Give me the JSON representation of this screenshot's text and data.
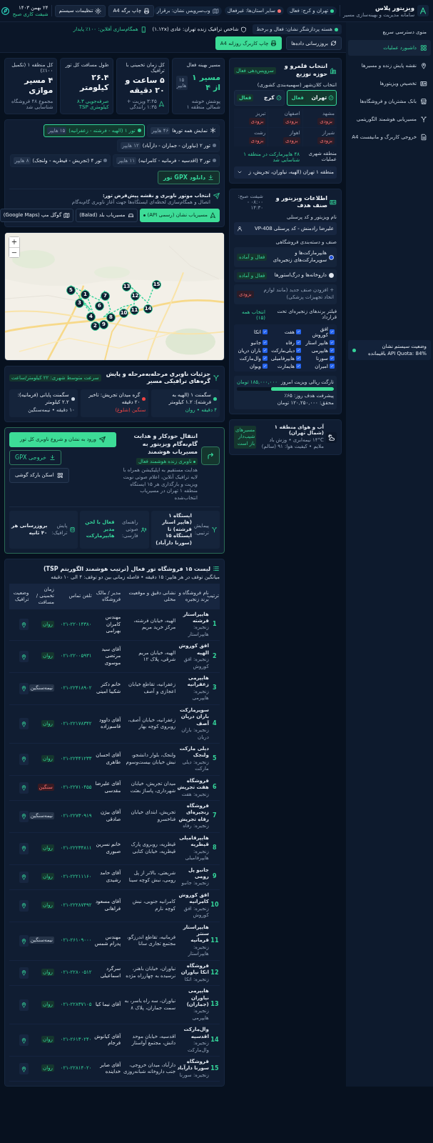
{
  "header": {
    "title": "ویزیتور پلاس",
    "subtitle": "سامانه مدیریت و بهینه‌سازی مسیر",
    "pills": [
      {
        "label": "تهران و کرج: فعال",
        "color": "#34d399"
      },
      {
        "label": "سایر استان‌ها: غیرفعال",
        "color": "#f87171"
      },
      {
        "label": "وب‌سرویس نشان: برقرار"
      }
    ],
    "buttons": [
      "چاپ برگه A4",
      "تنظیمات سیستم"
    ],
    "date": "۲۴ بهمن ۱۴۰۳",
    "shift": "شیفت کاری صبح"
  },
  "toolbar": {
    "statuses": [
      "هسته پردازشگر نشان: فعال و برخط",
      "شاخص ترافیک زنده تهران: عادی (۱.۱۲x)",
      "همگام‌سازی آفلاین: ۱۰۰٪ پایدار"
    ],
    "buttons": [
      {
        "label": "بروزرسانی داده‌ها",
        "kind": "secondary"
      },
      {
        "label": "چاپ کاربرگ روزانه A4",
        "kind": "primary"
      }
    ]
  },
  "sidebar": {
    "title": "منوی دسترسی سریع",
    "items": [
      {
        "label": "داشبورد عملیات",
        "selected": true
      },
      {
        "label": "نقشه پایش زنده و مسیرها",
        "selected": false
      },
      {
        "label": "تخصیص ویزیتورها",
        "selected": false
      },
      {
        "label": "بانک مشتریان و فروشگاه‌ها",
        "selected": false
      },
      {
        "label": "مسیریابی هوشمند الگوریتمی",
        "selected": false
      },
      {
        "label": "خروجی کاربرگ و مانیفست A4",
        "selected": false
      }
    ],
    "status": {
      "title": "وضعیت سیستم نشان",
      "quota": "API Quota: 84% باقیمانده"
    }
  },
  "stats": [
    {
      "label": "مسیر بهینه فعال",
      "value": "مسیر ۱ از ۴",
      "badge": "۱۵ هایپر",
      "note": "پوشش خوشه شمالی منطقه ۱",
      "value_accent": true,
      "note_accent": false
    },
    {
      "label": "کل زمان تخمینی با ترافیک",
      "value": "۵ ساعت و ۲۰ دقیقه",
      "note": "۳:۴۵ ویزیت + ۱:۳۵ رانندگی",
      "value_accent": false,
      "note_accent": false
    },
    {
      "label": "طول مسافت کل تور",
      "value": "۲۶.۴ کیلومتر",
      "note": "صرفه‌جویی ۸.۳ کیلومتری TSP",
      "value_accent": false,
      "note_accent": true
    },
    {
      "label": "کل منطقه ۱ (تکمیل ۱۰۰٪)",
      "value": "۴ مسیر موازی",
      "note": "مجموع ۴۸ فروشگاه شناسایی شد",
      "value_accent": false,
      "note_accent": false
    }
  ],
  "territory": {
    "title": "انتخاب قلمرو و حوزه توزیع",
    "badge": "سرویس‌دهی فعال",
    "city_label": "انتخاب کلان‌شهر (سهمیه‌بندی کشوری)",
    "cities": [
      {
        "name": "تهران",
        "badge": "فعال",
        "selected": true,
        "disabled": false
      },
      {
        "name": "کرج",
        "badge": "فعال",
        "selected": false,
        "disabled": false
      },
      {
        "name": "مشهد",
        "badge": "بزودی",
        "selected": false,
        "disabled": true
      },
      {
        "name": "اصفهان",
        "badge": "بزودی",
        "selected": false,
        "disabled": true
      },
      {
        "name": "تبریز",
        "badge": "بزودی",
        "selected": false,
        "disabled": true
      },
      {
        "name": "شیراز",
        "badge": "بزودی",
        "selected": false,
        "disabled": true
      },
      {
        "name": "اهواز",
        "badge": "بزودی",
        "selected": false,
        "disabled": true
      },
      {
        "name": "رشت",
        "badge": "بزودی",
        "selected": false,
        "disabled": true
      }
    ],
    "region_label": "منطقه شهری عملیات",
    "region_count": "۴۸ هایپرمارکت در منطقه ۱ شناسایی شد",
    "region_value": "منطقه ۱ تهران (الهیه، نیاوران، تجریش، ز"
  },
  "salesperson": {
    "title": "اطلاعات ویزیتور و صنف هدف",
    "shift": "شیفت صبح: ۰۸:۰۰ - ۱۴:۳۰",
    "name_label": "نام ویزیتور و کد پرسنلی",
    "name_value": "علیرضا رادمنش - کد پرسنلی VP-408",
    "category_label": "صنف و دسته‌بندی فروشگاهی",
    "categories": [
      {
        "kind": "radio",
        "label": "هایپرمارکت‌ها و سوپرمارکت‌های زنجیره‌ای",
        "badge": "فعال و آماده",
        "selected": true
      },
      {
        "kind": "radio",
        "label": "داروخانه‌ها و درگ‌استورها",
        "badge": "فعال و آماده",
        "selected": false
      },
      {
        "kind": "add",
        "label": "+ افزودن صنف جدید (مانند لوازم اتحاد تجهیزات پزشکی)",
        "badge": "بزودی"
      }
    ],
    "brands_label": "فیلتر برندهای زنجیره‌ای تحت قرارداد",
    "select_all": "انتخاب همه (۱۵)",
    "brands": [
      {
        "label": "افق کوروش",
        "checked": true
      },
      {
        "label": "هفت",
        "checked": true
      },
      {
        "label": "اتکا",
        "checked": true
      },
      {
        "label": "هایپر استار",
        "checked": true
      },
      {
        "label": "رفاه",
        "checked": true
      },
      {
        "label": "جانبو",
        "checked": true
      },
      {
        "label": "هایپرمی",
        "checked": true
      },
      {
        "label": "دیلی‌مارکت",
        "checked": true
      },
      {
        "label": "باران دریان",
        "checked": true
      },
      {
        "label": "سورنا",
        "checked": true
      },
      {
        "label": "هایپرفامیلی",
        "checked": true
      },
      {
        "label": "وال‌مارکت",
        "checked": true
      },
      {
        "label": "امیران",
        "checked": true
      },
      {
        "label": "هایمارت",
        "checked": true
      },
      {
        "label": "ویوان",
        "checked": true
      }
    ],
    "target": {
      "label": "تارگت ریالی ویزیت امروز",
      "amount": "۱۸۵,۰۰۰,۰۰۰ تومان",
      "level": 0.65,
      "progress": "پیشرفت هدف روز: ۶۵٪",
      "achieved": "محقق: ۱۲۰,۲۵۰,۰۰۰ تومان"
    }
  },
  "weather": {
    "title": "آب و هوای منطقه ۱ (شمال تهران)",
    "details": "۱۴°C نیمه‌ابری • وزش باد ملایم • کیفیت هوا: ۹۱ (سالم)",
    "badge": "مسیرهای شیب‌دار باز است"
  },
  "routes": {
    "tours": [
      {
        "kind": "all",
        "label": "نمایش همه تورها",
        "count": "۴۶ هایپر",
        "selected": false
      },
      {
        "kind": "tour",
        "label": "تور ۱ (الهیه - فرشته - زعفرانیه)",
        "count": "۱۵ هایپر",
        "selected": true
      },
      {
        "kind": "tour",
        "label": "تور ۲ (نیاوران - جماران - دارآباد)",
        "count": "۱۲ هایپر",
        "selected": false
      },
      {
        "kind": "tour",
        "label": "تور ۳ (اقدسیه - فرمانیه - کامرانیه)",
        "count": "۱۱ هایپر",
        "selected": false
      },
      {
        "kind": "tour",
        "label": "تور ۴ (تجریش - قیطریه - ولنجک)",
        "count": "۸ هایپر",
        "selected": false
      }
    ],
    "gpx_button": "دانلود GPX تور",
    "engine": {
      "title": "انتخاب موتور ناوبری و نقشه پیش‌فرض تور:",
      "desc": "اتصال و همگام‌سازی لحظه‌ای ایستگاه‌ها جهت آغاز ناوبری گام‌به‌گام",
      "options": [
        {
          "label": "مسیریاب نشان (رسمی API)",
          "selected": true
        },
        {
          "label": "مسیریاب بلد (Balad)",
          "selected": false
        },
        {
          "label": "گوگل مپ (Google Maps)",
          "selected": false
        }
      ]
    }
  },
  "map": {
    "zoom_in": "+",
    "zoom_out": "−",
    "markers": [
      "1",
      "2",
      "3",
      "4",
      "5",
      "6",
      "7",
      "8",
      "9",
      "10",
      "11",
      "12",
      "13",
      "14",
      "15"
    ]
  },
  "segments": {
    "title": "جزئیات ناوبری مرحله‌به‌مرحله و پایش گره‌های ترافیکی مسیر",
    "badge": "سرعت متوسط شهری: ۲۲ کیلومتر/ساعت",
    "items": [
      {
        "label": "سگمنت ۱ (الهیه به فرشته): ۱.۲ کیلومتر",
        "status": "۴ دقیقه • روان",
        "color": "#34d399"
      },
      {
        "label": "گره میدان تجریش: تاخیر ۲۰ دقیقه",
        "status": "سنگین (شلوغ)",
        "color": "#ef4444"
      },
      {
        "label": "سگمنت پایانی (فرمانیه): ۲.۲ کیلومتر",
        "status": "۱۰ دقیقه • نیمه‌سنگین",
        "color": "#cbd5e1"
      }
    ]
  },
  "navigation": {
    "title": "انتقال خودکار و هدایت گام‌به‌گام ویزیتور به مسیریاب هوشمند",
    "badge": "ناوبری زنده هوشمند فعال",
    "desc": "هدایت مستقیم به اپلیکیشن همراه با لایه ترافیک آنلاین، اعلام صوتی نوبت ویزیت و بارگذاری هر ۱۵ ایستگاه منطقه ۱ تهران در مسیریاب انتخاب‌شده",
    "buttons": [
      {
        "label": "ورود به نشان و شروع ناوبری کل تور",
        "kind": "primary"
      },
      {
        "label": "خروجی GPX",
        "kind": "outline"
      },
      {
        "label": "اسکن بارکد گوشی",
        "kind": "plain"
      }
    ],
    "facts": [
      {
        "label": "پیمایش ترتیبی:",
        "value": "ایستگاه ۱ (هایپر استار فرشته) تا ایستگاه ۱۵ (سورنا دارآباد)",
        "accent": false
      },
      {
        "label": "راهنمای صوتی فارسی:",
        "value": "فعال با لحن مدیر هایپرمارکت",
        "accent": true
      },
      {
        "label": "پایش ترافیک:",
        "value": "بروزرسانی هر ۴۰ ثانیه",
        "accent": false
      }
    ]
  },
  "table": {
    "title": "لیست ۱۵ فروشگاه تور فعال (ترتیب هوشمند الگوریتم TSP)",
    "subtitle": "میانگین توقف در هر هایپر: ۱۵ دقیقه • فاصله زمانی بین دو توقف: ۴ الی ۱۰ دقیقه",
    "columns": [
      "ترتیب",
      "نام فروشگاه و برند زنجیره",
      "نشانی دقیق و موقعیت محلی",
      "مدیر / مالک فروشگاه",
      "تلفن تماس",
      "زمان تخمینی / مسافت",
      "وضعیت ترافیک"
    ],
    "rows": [
      {
        "rank": "1",
        "name": "هایپراستار فرشته",
        "chain": "زنجیره: هایپراستار",
        "address": "الهیه، خیابان فرشته، مرکز خرید مریم",
        "manager": "مهندس کامران بهرامی",
        "phone": "۰۲۱-۲۲۰۱۴۳۸۰",
        "traffic": "روان",
        "kind": "light"
      },
      {
        "rank": "2",
        "name": "افق کوروش الهیه",
        "chain": "زنجیره: افق کوروش",
        "address": "الهیه، خیابان مریم شرقی، پلاک ۱۲",
        "manager": "آقای سید مرتضی موسوی",
        "phone": "۰۲۱-۲۲۰۰۵۹۳۱",
        "traffic": "روان",
        "kind": "light"
      },
      {
        "rank": "3",
        "name": "هایپرمی زعفرانیه",
        "chain": "زنجیره: هایپرمی",
        "address": "زعفرانیه، تقاطع خیابان اعجازی و آصف",
        "manager": "خانم دکتر شکیبا امینی",
        "phone": "۰۲۱-۲۲۴۱۸۹۰۲",
        "traffic": "نیمه‌سنگین",
        "kind": "medium"
      },
      {
        "rank": "4",
        "name": "سوپرمارکت باران دریان آصف",
        "chain": "زنجیره: باران دریان",
        "address": "زعفرانیه، خیابان آصف، روبروی کوچه بهار",
        "manager": "آقای داوود قاسم‌زاده",
        "phone": "۰۲۱-۲۲۱۷۸۳۴۲",
        "traffic": "روان",
        "kind": "light"
      },
      {
        "rank": "5",
        "name": "دیلی مارکت ولنجک",
        "chain": "زنجیره: دیلی مارکت",
        "address": "ولنجک، بلوار دانشجو، نبش خیابان بیست‌وسوم",
        "manager": "آقای احسان طاهری",
        "phone": "۰۲۱-۲۲۴۴۱۲۳۳",
        "traffic": "روان",
        "kind": "light"
      },
      {
        "rank": "6",
        "name": "فروشگاه هفت تجریش",
        "chain": "زنجیره: هفت",
        "address": "میدان تجریش، خیابان شهرداری، پاساژ بعثت",
        "manager": "آقای علیرضا مقدسی",
        "phone": "۰۲۱-۲۲۷۱۰۴۵۵",
        "traffic": "سنگین",
        "kind": "heavy"
      },
      {
        "rank": "7",
        "name": "فروشگاه زنجیره‌ای رفاه تجریش",
        "chain": "زنجیره: رفاه",
        "address": "تجریش، ابتدای خیابان فناخسرو",
        "manager": "آقای بیژن صادقی",
        "phone": "۰۲۱-۲۲۷۳۰۹۱۹",
        "traffic": "نیمه‌سنگین",
        "kind": "medium"
      },
      {
        "rank": "8",
        "name": "هایپرفامیلی قیطریه",
        "chain": "زنجیره: هایپرفامیلی",
        "address": "قیطریه، روبروی پارک قیطریه، خیابان کتابی",
        "manager": "خانم نسرین صبوری",
        "phone": "۰۲۱-۲۲۲۳۴۸۱۱",
        "traffic": "روان",
        "kind": "light"
      },
      {
        "rank": "9",
        "name": "جانبو پل رومی",
        "chain": "زنجیره: جانبو",
        "address": "شریعتی، بالاتر از پل رومی، نبش کوچه سینا",
        "manager": "آقای حامد رشیدی",
        "phone": "۰۲۱-۲۲۲۱۱۱۶۰",
        "traffic": "روان",
        "kind": "light"
      },
      {
        "rank": "10",
        "name": "افق کوروش کامرانیه",
        "chain": "زنجیره: افق کوروش",
        "address": "کامرانیه جنوبی، نبش کوچه نارم",
        "manager": "آقای مسعود فراهانی",
        "phone": "۰۲۱-۲۲۲۸۷۴۹۲",
        "traffic": "روان",
        "kind": "light"
      },
      {
        "rank": "11",
        "name": "هایپراستار سنتر فرمانیه",
        "chain": "زنجیره: هایپراستار",
        "address": "فرمانیه، تقاطع اندرزگو، مجتمع تجاری سانا",
        "manager": "مهندس پدرام شمس",
        "phone": "۰۲۱-۲۶۱۰۹۰۰۰",
        "traffic": "نیمه‌سنگین",
        "kind": "medium"
      },
      {
        "rank": "12",
        "name": "فروشگاه اتکا نیاوران",
        "chain": "زنجیره: اتکا",
        "address": "نیاوران، خیابان باهنر، نرسیده به چهارراه مژده",
        "manager": "سرگرد اسماعیلی",
        "phone": "۰۲۱-۲۲۸۰۰۵۱۲",
        "traffic": "روان",
        "kind": "light"
      },
      {
        "rank": "13",
        "name": "هایپرمی نیاوران (جماران)",
        "chain": "زنجیره: هایپرمی",
        "address": "نیاوران، سه راه یاسر، به سمت جماران، پلاک ۸",
        "manager": "آقای نیما کیا",
        "phone": "۰۲۱-۲۲۸۳۷۱۰۵",
        "traffic": "روان",
        "kind": "light"
      },
      {
        "rank": "14",
        "name": "وال‌مارکت اقدسیه",
        "chain": "زنجیره: وال‌مارکت",
        "address": "اقدسیه، خیابان موحد دانش، مجتمع آوا‌ستار",
        "manager": "آقای کیانوش فرجام",
        "phone": "۰۲۱-۲۶۱۳۰۲۴۰",
        "traffic": "روان",
        "kind": "light"
      },
      {
        "rank": "15",
        "name": "فروشگاه سورنا دارآباد",
        "chain": "زنجیره: سورنا",
        "address": "دارآباد، میدان خروجی، جنب داروخانه شبانه‌روزی",
        "manager": "آقای صابر خداینده",
        "phone": "۰۲۱-۲۲۸۱۴۰۲۰",
        "traffic": "روان",
        "kind": "light"
      }
    ]
  }
}
